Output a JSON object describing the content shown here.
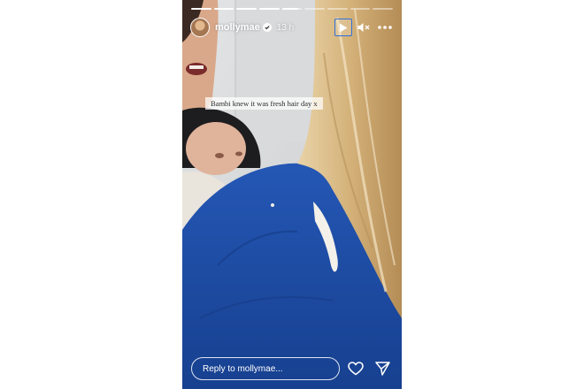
{
  "story": {
    "progress": {
      "segment_count": 9,
      "completed_segments": 4,
      "current_segment_index": 4,
      "current_segment_progress": 0.8
    },
    "header": {
      "username": "mollymae",
      "verified": true,
      "time_ago": "13 h",
      "icons": [
        "play-icon",
        "mute-icon",
        "more-icon"
      ]
    },
    "caption": "Bambi knew it was fresh hair day x",
    "footer": {
      "reply_placeholder": "Reply to mollymae...",
      "icons": [
        "heart-icon",
        "send-icon"
      ]
    }
  },
  "colors": {
    "accent": "#2f6fd8",
    "jumper_blue": "#1f4fa8"
  }
}
